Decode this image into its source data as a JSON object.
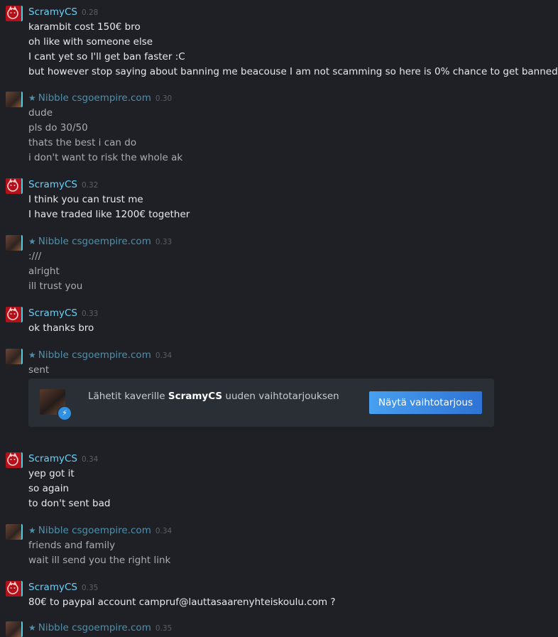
{
  "messages": [
    {
      "sender": "ScramyCS",
      "self": true,
      "time": "0.28",
      "lines": [
        "karambit cost 150€ bro",
        "oh like with someone else",
        "I cant yet so I'll get ban faster :C",
        "but however stop saying about banning me beacouse I am not scamming so here is 0% chance to get banned"
      ]
    },
    {
      "sender": "Nibble csgoempire.com",
      "self": false,
      "time": "0.30",
      "lines": [
        "dude",
        "pls do 30/50",
        "thats the best i can do",
        "i don't want to risk the whole ak"
      ]
    },
    {
      "sender": "ScramyCS",
      "self": true,
      "time": "0.32",
      "lines": [
        "I think you can trust me",
        "I have traded like 1200€ together"
      ]
    },
    {
      "sender": "Nibble csgoempire.com",
      "self": false,
      "time": "0.33",
      "lines": [
        ":///",
        "alright",
        "ill trust you"
      ]
    },
    {
      "sender": "ScramyCS",
      "self": true,
      "time": "0.33",
      "lines": [
        "ok thanks bro"
      ]
    },
    {
      "sender": "Nibble csgoempire.com",
      "self": false,
      "time": "0.34",
      "lines": [
        "sent"
      ]
    },
    {
      "sender": "ScramyCS",
      "self": true,
      "time": "0.34",
      "lines": [
        "yep got it",
        "so again",
        "to don't sent bad"
      ]
    },
    {
      "sender": "Nibble csgoempire.com",
      "self": false,
      "time": "0.34",
      "lines": [
        "friends and family",
        "wait ill send you the right link"
      ]
    },
    {
      "sender": "ScramyCS",
      "self": true,
      "time": "0.35",
      "lines": [
        "80€ to paypal account campruf@lauttasaarenyhteiskoulu.com ?"
      ]
    },
    {
      "sender": "Nibble csgoempire.com",
      "self": false,
      "time": "0.35",
      "lines": []
    }
  ],
  "trade_offer": {
    "text_before": "Lähetit kaverille ",
    "friend_name": "ScramyCS",
    "text_after": " uuden vaihtotarjouksen",
    "button_label": "Näytä vaihtotarjous",
    "badge_icon": "lightning-icon",
    "badge_glyph": "⚡"
  },
  "star_glyph": "★",
  "colors": {
    "self_name": "#6dcff6",
    "friend_name": "#4c91ac",
    "button": "#3b8ae6",
    "background": "#1e2026"
  }
}
